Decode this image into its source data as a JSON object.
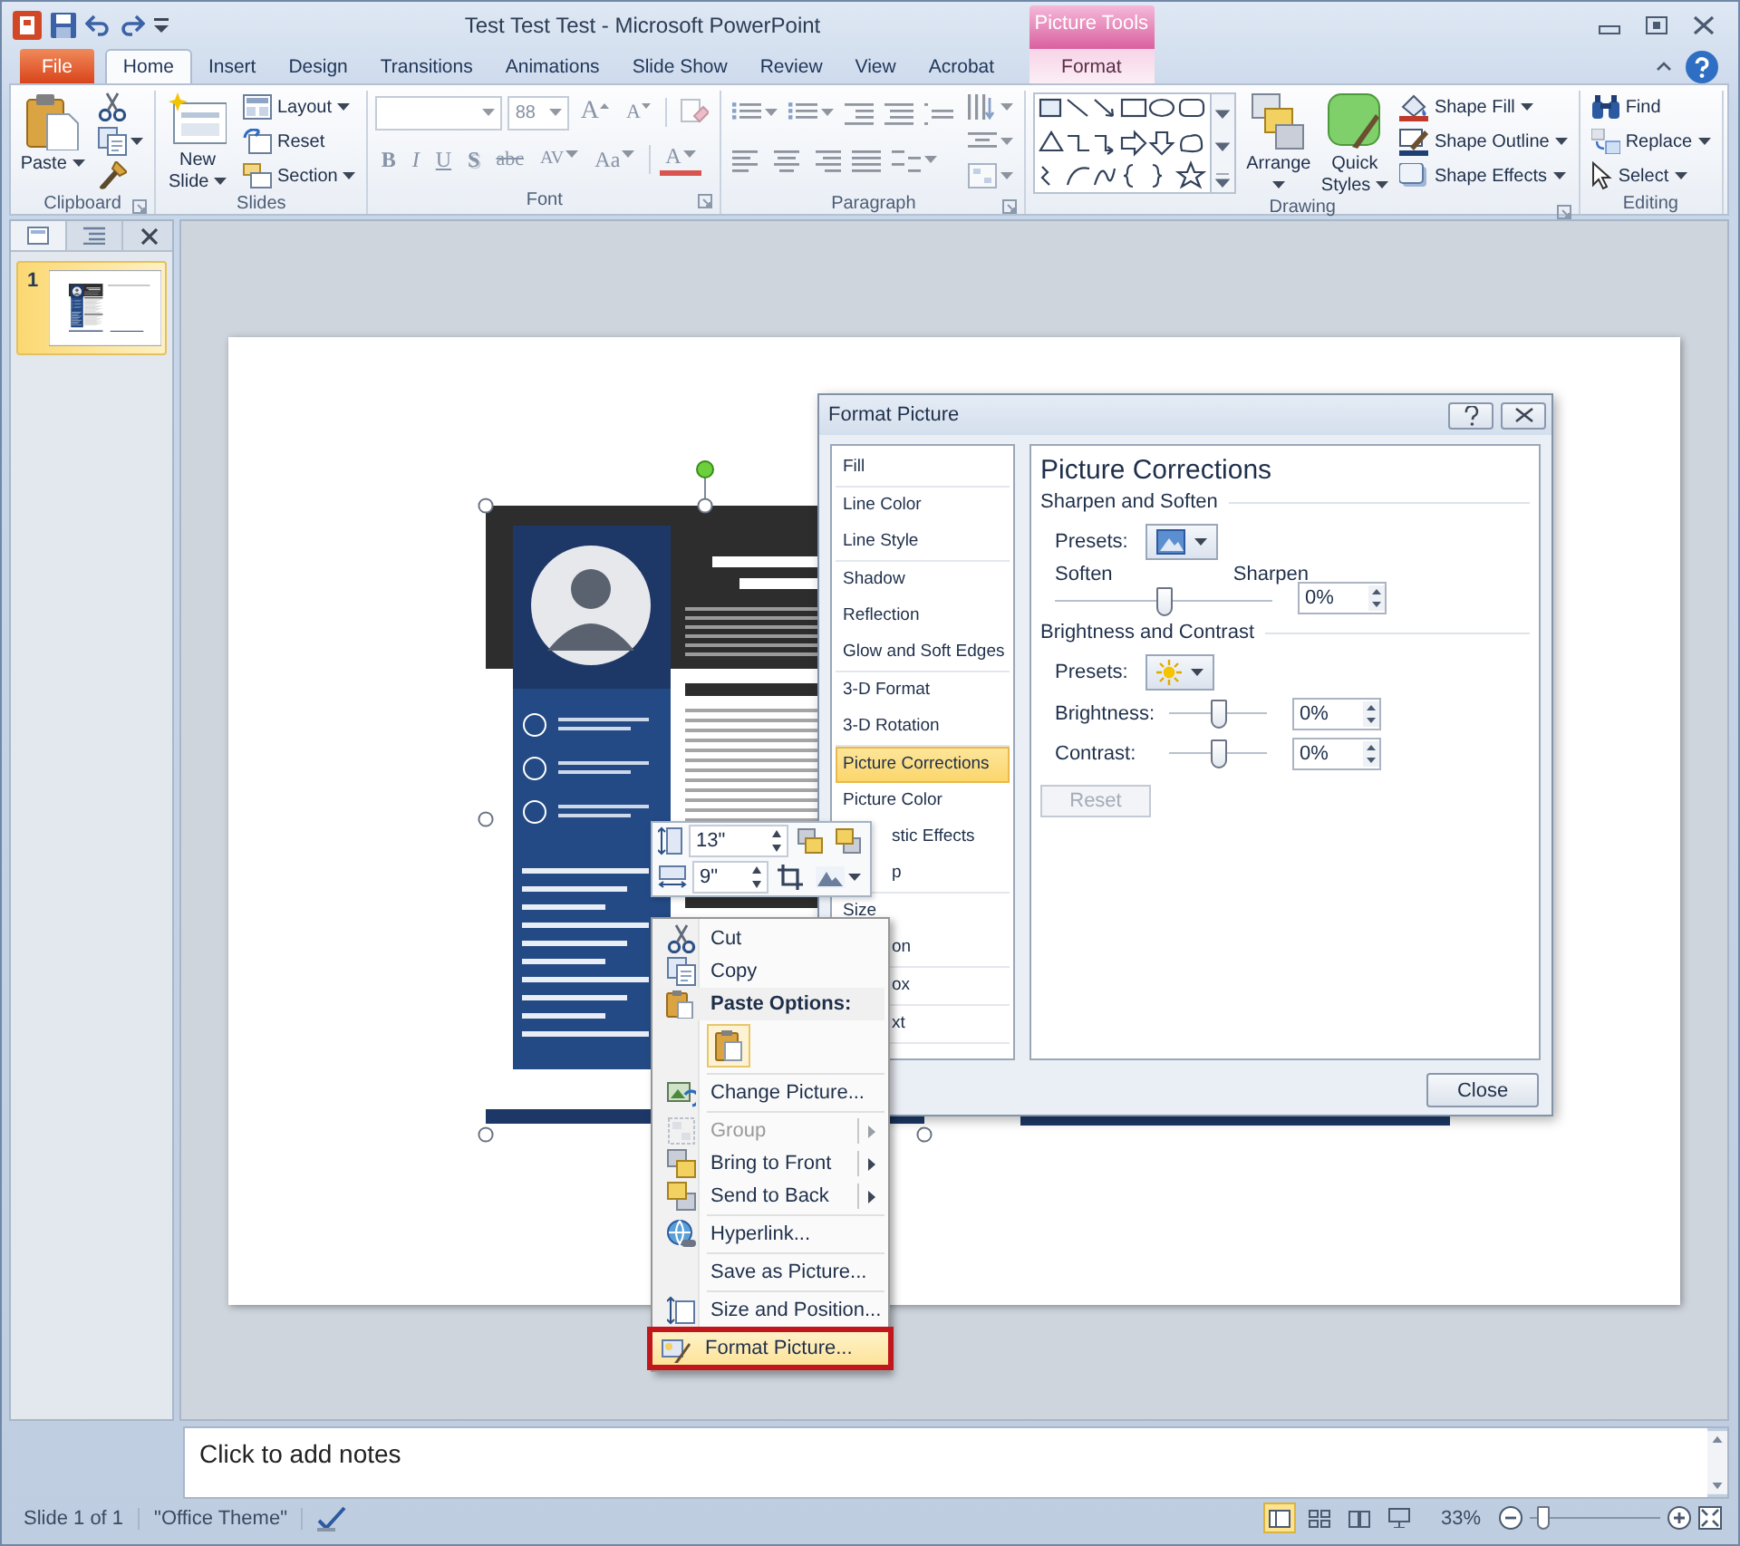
{
  "window": {
    "title": "Test Test Test - Microsoft PowerPoint"
  },
  "contextual_group": {
    "label": "Picture Tools"
  },
  "tabs": [
    {
      "label": "File",
      "kind": "file",
      "selected": false
    },
    {
      "label": "Home",
      "kind": "normal",
      "selected": true
    },
    {
      "label": "Insert",
      "kind": "normal",
      "selected": false
    },
    {
      "label": "Design",
      "kind": "normal",
      "selected": false
    },
    {
      "label": "Transitions",
      "kind": "normal",
      "selected": false
    },
    {
      "label": "Animations",
      "kind": "normal",
      "selected": false
    },
    {
      "label": "Slide Show",
      "kind": "normal",
      "selected": false
    },
    {
      "label": "Review",
      "kind": "normal",
      "selected": false
    },
    {
      "label": "View",
      "kind": "normal",
      "selected": false
    },
    {
      "label": "Acrobat",
      "kind": "normal",
      "selected": false
    },
    {
      "label": "Format",
      "kind": "contextual",
      "selected": false
    }
  ],
  "ribbon": {
    "groups": [
      {
        "label": "Clipboard",
        "kind": "buttons",
        "launcher": true,
        "buttons": [
          {
            "kind": "large",
            "label": "Paste",
            "caret": true
          },
          {
            "kind": "icon",
            "caret": false
          },
          {
            "kind": "icon",
            "caret": true
          },
          {
            "kind": "icon",
            "caret": false
          }
        ]
      },
      {
        "label": "Slides",
        "kind": "buttons",
        "launcher": false,
        "buttons": [
          {
            "kind": "large",
            "label": "New Slide",
            "caret": true
          },
          {
            "kind": "small",
            "label": "Layout",
            "caret": true
          },
          {
            "kind": "small",
            "label": "Reset",
            "caret": false
          },
          {
            "kind": "small",
            "label": "Section",
            "caret": true
          }
        ]
      },
      {
        "label": "Font",
        "kind": "font",
        "launcher": true,
        "disabled": true,
        "size": "88",
        "size_buttons": [
          "A",
          "A"
        ],
        "format_buttons": [
          "B",
          "I",
          "U",
          "S",
          "abc",
          "AV",
          "Aa",
          "A"
        ]
      },
      {
        "label": "Paragraph",
        "kind": "paragraph",
        "launcher": true,
        "disabled": true
      },
      {
        "label": "Drawing",
        "kind": "buttons",
        "launcher": true,
        "buttons": [
          {
            "kind": "gallery"
          },
          {
            "kind": "large",
            "label": "Arrange",
            "caret": true
          },
          {
            "kind": "large",
            "label": "Quick Styles",
            "caret": true
          },
          {
            "kind": "small",
            "label": "Shape Fill",
            "caret": true
          },
          {
            "kind": "small",
            "label": "Shape Outline",
            "caret": true
          },
          {
            "kind": "small",
            "label": "Shape Effects",
            "caret": true
          }
        ]
      },
      {
        "label": "Editing",
        "kind": "buttons",
        "launcher": false,
        "buttons": [
          {
            "kind": "small",
            "label": "Find",
            "caret": false
          },
          {
            "kind": "small",
            "label": "Replace",
            "caret": true
          },
          {
            "kind": "small",
            "label": "Select",
            "caret": true
          }
        ]
      }
    ]
  },
  "slides_pane": {
    "tabs": [
      {
        "kind": "slides",
        "selected": true
      },
      {
        "kind": "outline",
        "selected": false
      }
    ],
    "thumbnails": [
      {
        "number": "1",
        "selected": true
      }
    ]
  },
  "slide": {
    "picture": {
      "selected": true
    }
  },
  "notes": {
    "placeholder": "Click to add notes"
  },
  "status_bar": {
    "slide_info": "Slide 1 of 1",
    "theme": "\"Office Theme\"",
    "views": [
      {
        "kind": "normal",
        "selected": true
      },
      {
        "kind": "sorter",
        "selected": false
      },
      {
        "kind": "reading",
        "selected": false
      },
      {
        "kind": "slideshow",
        "selected": false
      }
    ],
    "zoom": "33%",
    "zoom_slider": {
      "level": 0.1
    }
  },
  "mini_toolbar": {
    "fields": [
      {
        "value": "13\""
      },
      {
        "value": "9\""
      }
    ]
  },
  "context_menu": {
    "items": [
      {
        "kind": "item",
        "label": "Cut",
        "disabled": false,
        "submenu": false,
        "selected": false,
        "annotated": false
      },
      {
        "kind": "item",
        "label": "Copy",
        "disabled": false,
        "submenu": false,
        "selected": false,
        "annotated": false
      },
      {
        "kind": "header",
        "label": "Paste Options:"
      },
      {
        "kind": "paste"
      },
      {
        "kind": "separator"
      },
      {
        "kind": "item",
        "label": "Change Picture...",
        "disabled": false,
        "submenu": false,
        "selected": false,
        "annotated": false
      },
      {
        "kind": "separator"
      },
      {
        "kind": "item",
        "label": "Group",
        "disabled": true,
        "submenu": true,
        "selected": false,
        "annotated": false
      },
      {
        "kind": "item",
        "label": "Bring to Front",
        "disabled": false,
        "submenu": true,
        "selected": false,
        "annotated": false
      },
      {
        "kind": "item",
        "label": "Send to Back",
        "disabled": false,
        "submenu": true,
        "selected": false,
        "annotated": false
      },
      {
        "kind": "separator"
      },
      {
        "kind": "item",
        "label": "Hyperlink...",
        "disabled": false,
        "submenu": false,
        "selected": false,
        "annotated": false
      },
      {
        "kind": "separator"
      },
      {
        "kind": "item",
        "label": "Save as Picture...",
        "disabled": false,
        "submenu": false,
        "selected": false,
        "annotated": false
      },
      {
        "kind": "separator"
      },
      {
        "kind": "item",
        "label": "Size and Position...",
        "disabled": false,
        "submenu": false,
        "selected": false,
        "annotated": false
      },
      {
        "kind": "item",
        "label": "Format Picture...",
        "disabled": false,
        "submenu": false,
        "selected": true,
        "annotated": true
      }
    ]
  },
  "dialog": {
    "title": "Format Picture",
    "categories": [
      {
        "items": [
          {
            "label": "Fill",
            "selected": false,
            "kind": "full"
          }
        ]
      },
      {
        "items": [
          {
            "label": "Line Color",
            "selected": false,
            "kind": "full"
          },
          {
            "label": "Line Style",
            "selected": false,
            "kind": "full"
          }
        ]
      },
      {
        "items": [
          {
            "label": "Shadow",
            "selected": false,
            "kind": "full"
          },
          {
            "label": "Reflection",
            "selected": false,
            "kind": "full"
          },
          {
            "label": "Glow and Soft Edges",
            "selected": false,
            "kind": "full"
          }
        ]
      },
      {
        "items": [
          {
            "label": "3-D Format",
            "selected": false,
            "kind": "full"
          },
          {
            "label": "3-D Rotation",
            "selected": false,
            "kind": "full"
          }
        ]
      },
      {
        "items": [
          {
            "label": "Picture Corrections",
            "selected": true,
            "kind": "full"
          },
          {
            "label": "Picture Color",
            "selected": false,
            "kind": "full"
          },
          {
            "label": "stic Effects",
            "selected": false,
            "kind": "clipped"
          },
          {
            "label": "p",
            "selected": false,
            "kind": "clipped"
          }
        ]
      },
      {
        "items": [
          {
            "label": "Size",
            "selected": false,
            "kind": "full"
          },
          {
            "label": "on",
            "selected": false,
            "kind": "clipped"
          }
        ]
      },
      {
        "items": [
          {
            "label": "ox",
            "selected": false,
            "kind": "clipped"
          }
        ]
      },
      {
        "items": [
          {
            "label": "xt",
            "selected": false,
            "kind": "clipped"
          }
        ]
      }
    ],
    "heading": "Picture Corrections",
    "sections": [
      {
        "title": "Sharpen and Soften",
        "presets_label": "Presets:",
        "sliders": [
          {
            "kind": "ends",
            "left_label": "Soften",
            "right_label": "Sharpen",
            "level": 0.5,
            "value": "0%"
          }
        ]
      },
      {
        "title": "Brightness and Contrast",
        "presets_label": "Presets:",
        "sliders": [
          {
            "kind": "labeled",
            "label": "Brightness:",
            "level": 0.5,
            "value": "0%"
          },
          {
            "kind": "labeled",
            "label": "Contrast:",
            "level": 0.5,
            "value": "0%"
          }
        ]
      }
    ],
    "reset": {
      "label": "Reset",
      "disabled": true
    },
    "close": {
      "label": "Close"
    }
  }
}
